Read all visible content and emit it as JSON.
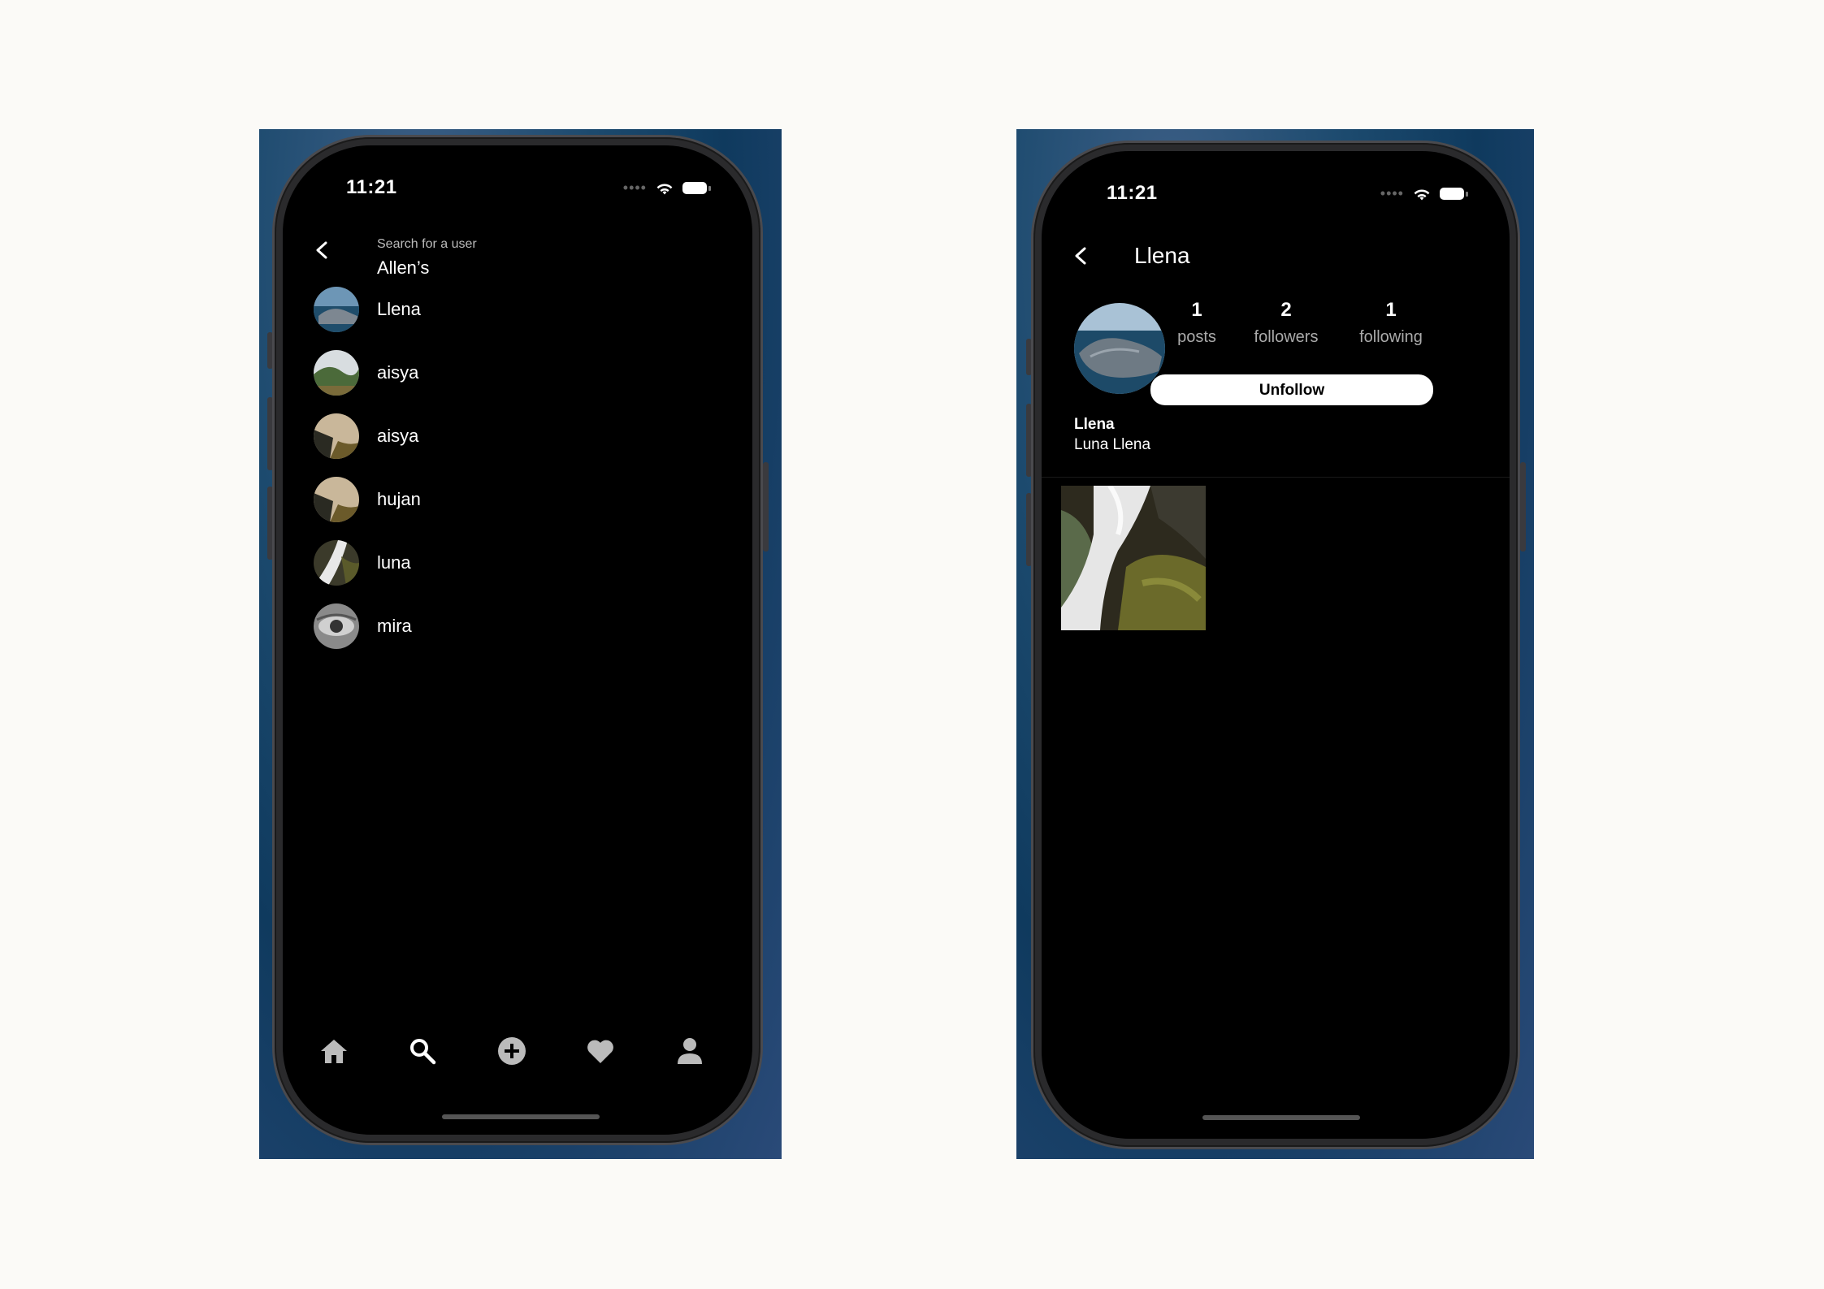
{
  "left": {
    "status": {
      "time": "11:21"
    },
    "search": {
      "label": "Search for a user",
      "value": "Allen’s"
    },
    "users": [
      {
        "name": "Llena",
        "avatar": "ocean-rock-avatar"
      },
      {
        "name": "aisya",
        "avatar": "valley-avatar"
      },
      {
        "name": "aisya",
        "avatar": "coast-sunset-avatar"
      },
      {
        "name": "hujan",
        "avatar": "coast-sunset-avatar"
      },
      {
        "name": "luna",
        "avatar": "waterfall-avatar"
      },
      {
        "name": "mira",
        "avatar": "eye-avatar"
      }
    ],
    "tabs": [
      "home-icon",
      "search-icon",
      "add-circle-icon",
      "heart-icon",
      "person-icon"
    ]
  },
  "right": {
    "status": {
      "time": "11:21"
    },
    "header": {
      "title": "Llena"
    },
    "stats": [
      {
        "value": "1",
        "label": "posts"
      },
      {
        "value": "2",
        "label": "followers"
      },
      {
        "value": "1",
        "label": "following"
      }
    ],
    "action": {
      "label": "Unfollow"
    },
    "profile": {
      "username": "Llena",
      "full_name": "Luna Llena"
    },
    "posts": [
      {
        "image": "waterfall-post"
      }
    ]
  }
}
